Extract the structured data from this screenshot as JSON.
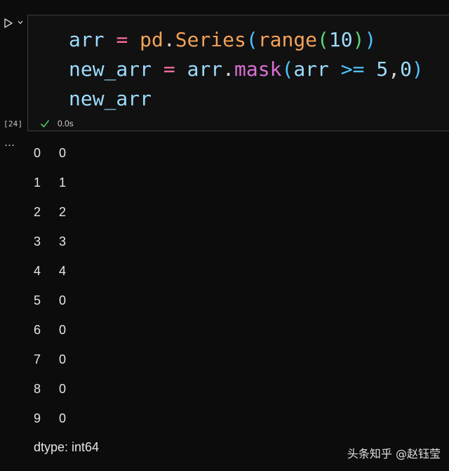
{
  "gutter": {
    "run_icon": "play-icon",
    "chevron_icon": "chevron-down-icon",
    "execution_count": "[24]",
    "output_collapse": "…"
  },
  "cell": {
    "code_lines": [
      "arr = pd.Series(range(10))",
      "new_arr = arr.mask(arr >= 5,0)",
      "new_arr"
    ],
    "status_icon": "check-icon",
    "exec_time": "0.0s"
  },
  "output": {
    "rows": [
      {
        "index": "0",
        "value": "0"
      },
      {
        "index": "1",
        "value": "1"
      },
      {
        "index": "2",
        "value": "2"
      },
      {
        "index": "3",
        "value": "3"
      },
      {
        "index": "4",
        "value": "4"
      },
      {
        "index": "5",
        "value": "0"
      },
      {
        "index": "6",
        "value": "0"
      },
      {
        "index": "7",
        "value": "0"
      },
      {
        "index": "8",
        "value": "0"
      },
      {
        "index": "9",
        "value": "0"
      }
    ],
    "dtype": "dtype: int64"
  },
  "watermark": "头条知乎 @赵钰莹",
  "colors": {
    "background": "#0c0c0c",
    "check": "#4ec959",
    "variable": "#9cdcfe",
    "function": "#e6b36a",
    "number": "#b5cea8"
  }
}
